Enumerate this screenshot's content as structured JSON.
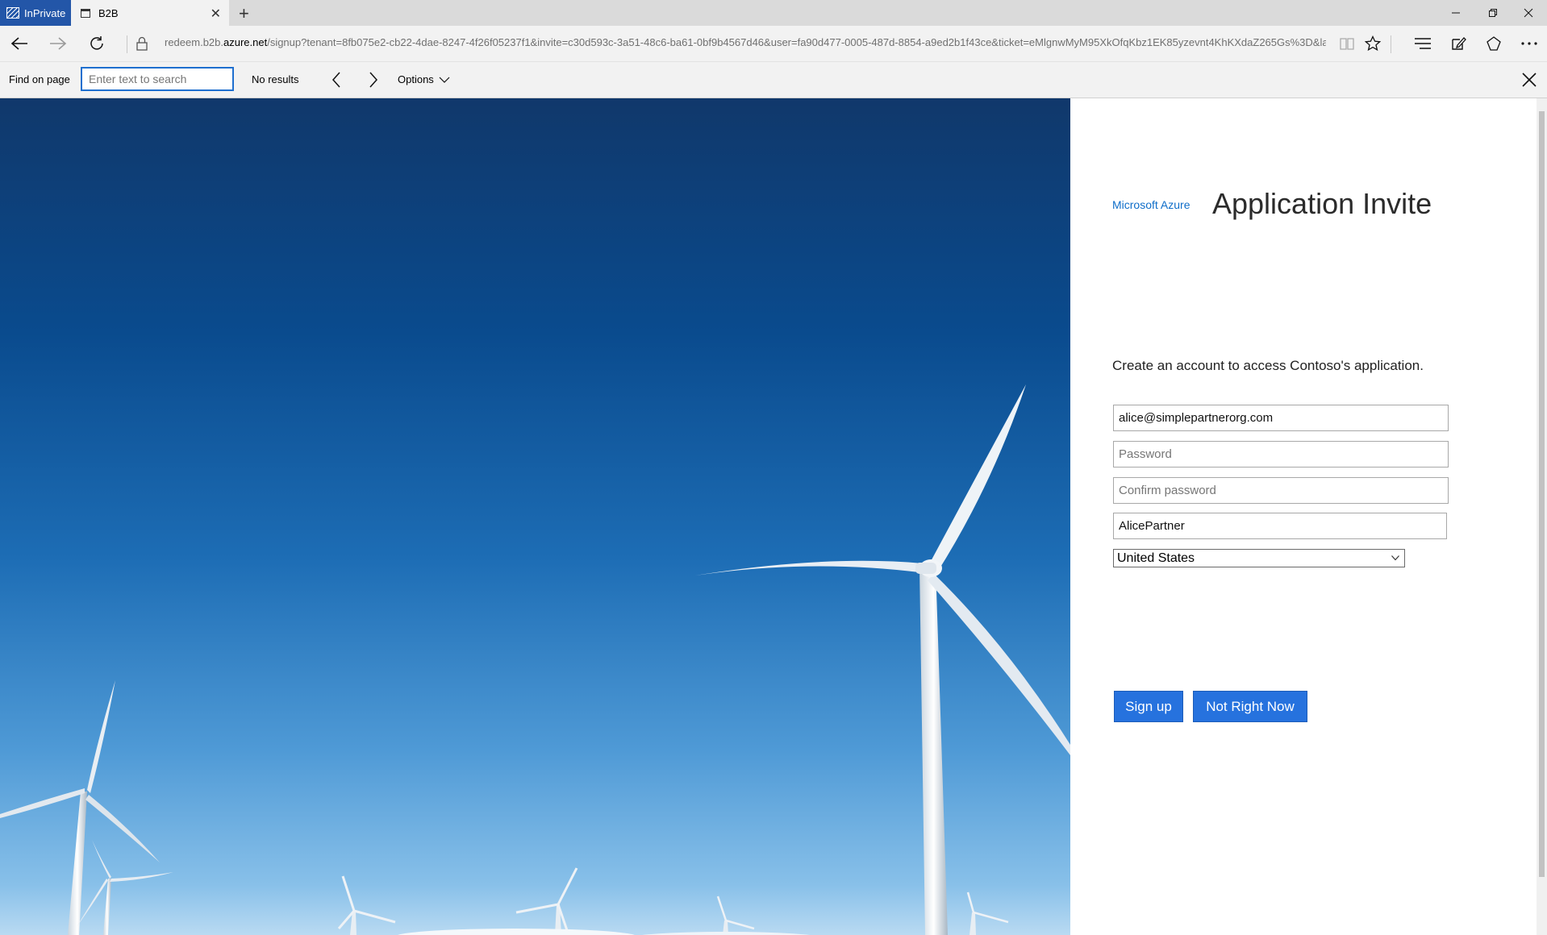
{
  "browser": {
    "inprivate_label": "InPrivate",
    "tab_title": "B2B",
    "url_prefix": "redeem.b2b.",
    "url_domain": "azure.net",
    "url_rest": "/signup?tenant=8fb075e2-cb22-4dae-8247-4f26f05237f1&invite=c30d593c-3a51-48c6-ba61-0bf9b4567d46&user=fa90d477-0005-487d-8854-a9ed2b1f43ce&ticket=eMlgnwMyM95XkOfqKbz1EK85yzevnt4KhKXdaZ265Gs%3D&la"
  },
  "findbar": {
    "label": "Find on page",
    "placeholder": "Enter text to search",
    "status": "No results",
    "options_label": "Options"
  },
  "page": {
    "brand": "Microsoft Azure",
    "title": "Application Invite",
    "intro": "Create an account to access Contoso's application.",
    "email_value": "alice@simplepartnerorg.com",
    "password_placeholder": "Password",
    "confirm_placeholder": "Confirm password",
    "display_name_value": "AlicePartner",
    "country_selected": "United States",
    "signup_label": "Sign up",
    "not_now_label": "Not Right Now"
  },
  "colors": {
    "accent": "#2672de",
    "brand_link": "#0e6dc9",
    "inprivate": "#2356a8"
  }
}
